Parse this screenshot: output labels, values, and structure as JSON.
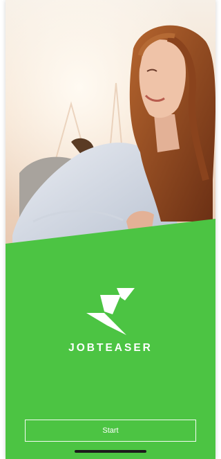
{
  "brand": {
    "name": "JOBTEASER",
    "green": "#4cc443",
    "logo_icon": "jobteaser-bolt-logo"
  },
  "hero": {
    "image": "smiling-woman-with-backpack-photo"
  },
  "actions": {
    "start_label": "Start"
  }
}
